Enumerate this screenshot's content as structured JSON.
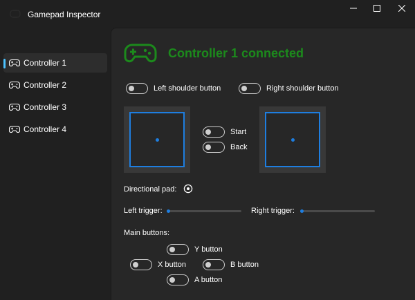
{
  "window": {
    "title": "Gamepad Inspector"
  },
  "sidebar": {
    "items": [
      {
        "label": "Controller 1",
        "selected": true
      },
      {
        "label": "Controller 2",
        "selected": false
      },
      {
        "label": "Controller 3",
        "selected": false
      },
      {
        "label": "Controller 4",
        "selected": false
      }
    ]
  },
  "main": {
    "status_text": "Controller 1 connected",
    "status_color": "#1c8a1c",
    "left_shoulder_label": "Left shoulder button",
    "right_shoulder_label": "Right shoulder button",
    "start_label": "Start",
    "back_label": "Back",
    "dpad_label": "Directional pad:",
    "left_trigger_label": "Left trigger:",
    "right_trigger_label": "Right trigger:",
    "left_trigger_value": 0,
    "right_trigger_value": 0,
    "main_buttons_label": "Main buttons:",
    "y_label": "Y button",
    "x_label": "X button",
    "b_label": "B button",
    "a_label": "A button",
    "left_stick": {
      "x": 0,
      "y": 0
    },
    "right_stick": {
      "x": 0,
      "y": 0
    }
  },
  "colors": {
    "accent": "#1e7ee0",
    "nav_indicator": "#4cc2ff"
  },
  "icons": {
    "app": "gamepad-icon",
    "status": "gamepad-icon",
    "dpad": "dpad-radio-icon",
    "nav": "gamepad-icon",
    "minimize": "minimize-icon",
    "maximize": "maximize-icon",
    "close": "close-icon"
  }
}
